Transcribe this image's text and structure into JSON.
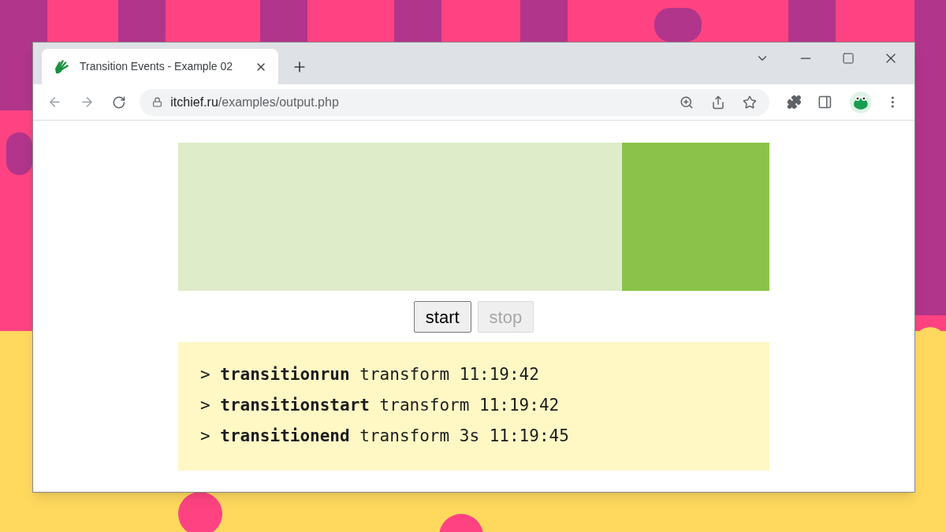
{
  "browser": {
    "tab": {
      "title": "Transition Events - Example 02",
      "selected": true
    },
    "address": {
      "domain": "itchief.ru",
      "path": "/examples/output.php"
    }
  },
  "demo": {
    "box": {
      "level": 1
    }
  },
  "buttons": [
    {
      "label": "start",
      "disabled": false
    },
    {
      "label": "stop",
      "disabled": true
    }
  ],
  "log": [
    "> **transitionrun** transform 11:19:42",
    "> **transitionstart** transform 11:19:42",
    "> **transitionend** transform 3s 11:19:45"
  ]
}
